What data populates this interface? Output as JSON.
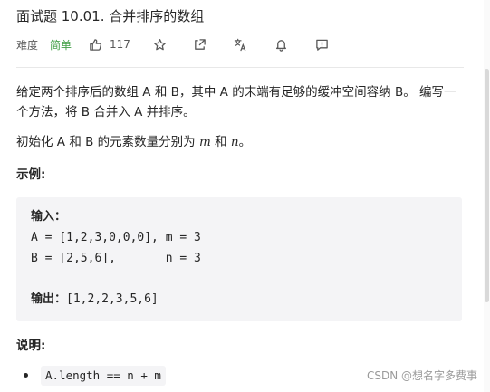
{
  "problem": {
    "title": "面试题 10.01. 合并排序的数组",
    "difficulty_label": "难度",
    "difficulty_value": "简单",
    "likes": "117"
  },
  "toolbar_icons": [
    "thumbs-up-icon",
    "star-icon",
    "share-icon",
    "translate-icon",
    "bell-icon",
    "feedback-icon"
  ],
  "description": {
    "paragraph": "给定两个排序后的数组 A 和 B，其中 A 的末端有足够的缓冲空间容纳 B。 编写一个方法，将 B 合并入 A 并排序。",
    "init_prefix": "初始化 A 和 B 的元素数量分别为 ",
    "init_m": "m",
    "init_and": " 和 ",
    "init_n": "n",
    "init_suffix": "。"
  },
  "example": {
    "heading": "示例:",
    "input_label": "输入：",
    "line_a": "A = [1,2,3,0,0,0], m = 3",
    "line_b": "B = [2,5,6],       n = 3",
    "output_label": "输出：",
    "output_value": "[1,2,2,3,5,6]"
  },
  "notes": {
    "heading": "说明:",
    "items": [
      "A.length == n + m"
    ]
  },
  "watermark": "CSDN @想名字多费事",
  "colors": {
    "difficulty_easy": "#43a047",
    "text": "#262626",
    "code_bg": "#f4f4f6",
    "divider": "#e8e8e8"
  }
}
